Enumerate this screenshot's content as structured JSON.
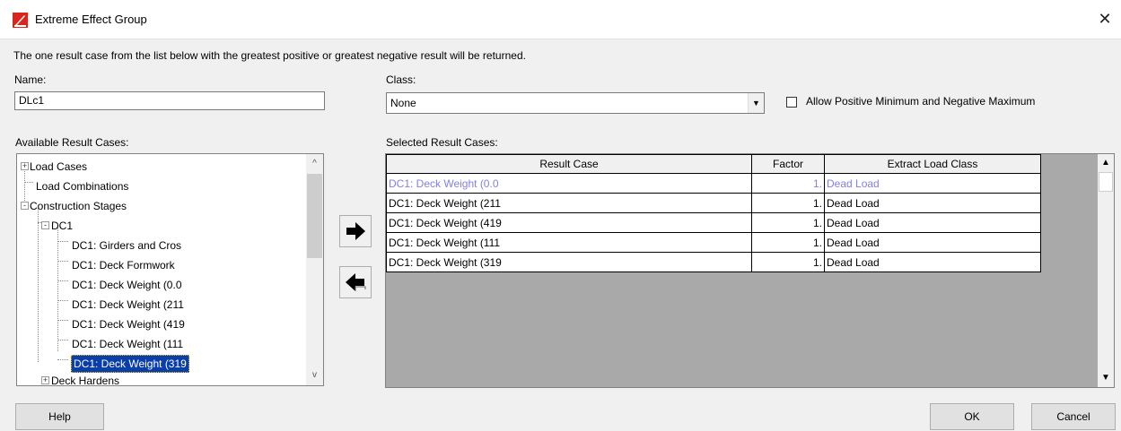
{
  "window": {
    "title": "Extreme Effect Group",
    "close_glyph": "✕"
  },
  "description": "The one result case from the list below with the greatest positive or greatest negative result will be returned.",
  "name_field": {
    "label": "Name:",
    "value": "DLc1"
  },
  "class_field": {
    "label": "Class:",
    "value": "None"
  },
  "allow_checkbox": {
    "label": "Allow Positive Minimum and Negative Maximum",
    "checked": false
  },
  "available": {
    "label": "Available Result Cases:",
    "nodes": [
      {
        "text": "Load Cases",
        "level": 0,
        "expander": "+"
      },
      {
        "text": "Load Combinations",
        "level": 0,
        "expander": ""
      },
      {
        "text": "Construction Stages",
        "level": 0,
        "expander": "-"
      },
      {
        "text": "DC1",
        "level": 1,
        "expander": "-"
      },
      {
        "text": "DC1: Girders and Cros",
        "level": 2,
        "expander": ""
      },
      {
        "text": "DC1: Deck Formwork",
        "level": 2,
        "expander": ""
      },
      {
        "text": "DC1: Deck Weight (0.0",
        "level": 2,
        "expander": ""
      },
      {
        "text": "DC1: Deck Weight (211",
        "level": 2,
        "expander": ""
      },
      {
        "text": "DC1: Deck Weight (419",
        "level": 2,
        "expander": ""
      },
      {
        "text": "DC1: Deck Weight (111",
        "level": 2,
        "expander": ""
      },
      {
        "text": "DC1: Deck Weight (319",
        "level": 2,
        "expander": "",
        "selected": true
      },
      {
        "text": "Deck Hardens",
        "level": 1,
        "expander": "+"
      }
    ]
  },
  "selected": {
    "label": "Selected Result Cases:",
    "columns": [
      "Result Case",
      "Factor",
      "Extract Load Class"
    ],
    "rows": [
      {
        "case": "DC1: Deck Weight (0.0",
        "factor": "1.",
        "load_class": "Dead Load",
        "highlight": true
      },
      {
        "case": "DC1: Deck Weight (211",
        "factor": "1.",
        "load_class": "Dead Load"
      },
      {
        "case": "DC1: Deck Weight (419",
        "factor": "1.",
        "load_class": "Dead Load"
      },
      {
        "case": "DC1: Deck Weight (111",
        "factor": "1.",
        "load_class": "Dead Load"
      },
      {
        "case": "DC1: Deck Weight (319",
        "factor": "1.",
        "load_class": "Dead Load"
      }
    ]
  },
  "buttons": {
    "add_icon": "arrow-right-icon",
    "remove_icon": "arrow-left-icon",
    "help": "Help",
    "ok": "OK",
    "cancel": "Cancel"
  },
  "colors": {
    "highlight_text": "#8080e8",
    "selection": "#0a3ea8",
    "grid_background": "#a9a9a9",
    "title_icon": "#d8261c"
  }
}
